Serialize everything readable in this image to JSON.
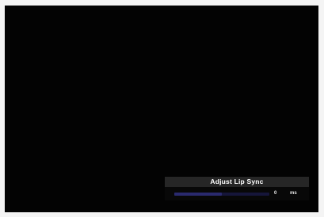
{
  "osd": {
    "title": "Adjust Lip Sync",
    "value": "0",
    "unit": "ms",
    "slider_fraction": 0.5
  },
  "colors": {
    "video_background": "#030303",
    "osd_title_bar": "#262626",
    "slider_track": "#16163a",
    "slider_fill": "#2a2a6e"
  }
}
